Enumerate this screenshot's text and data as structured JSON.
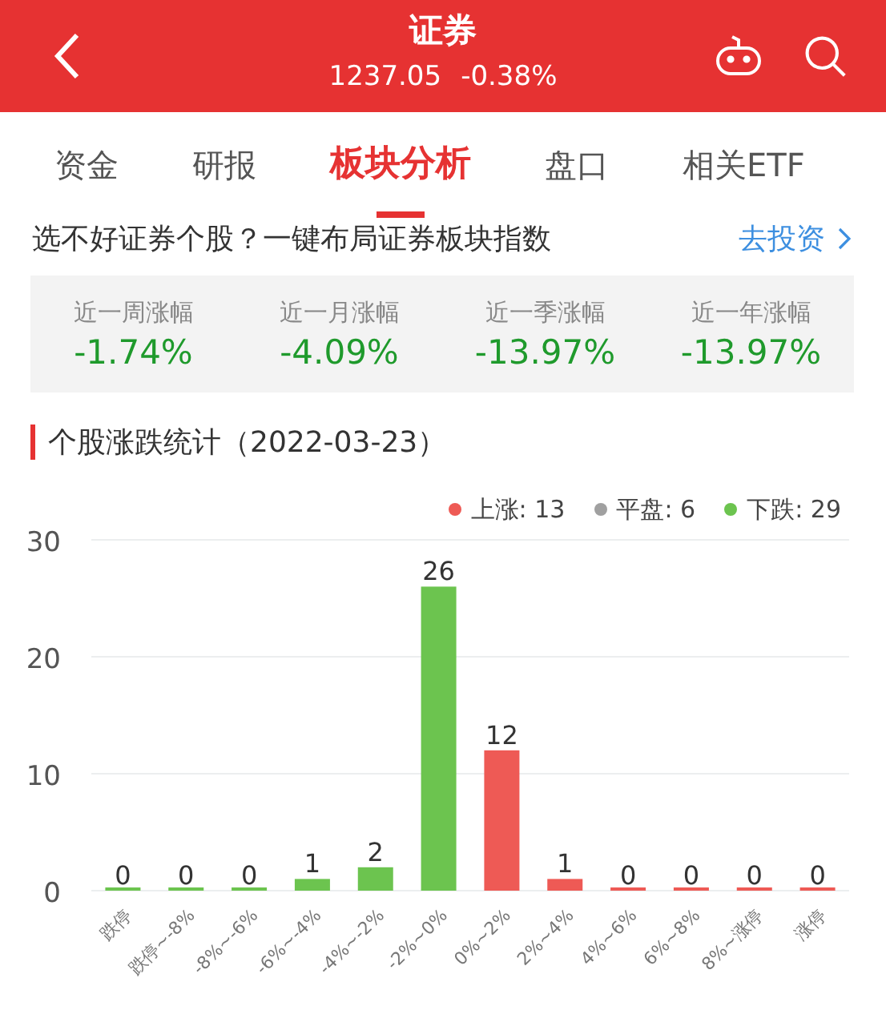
{
  "header": {
    "title": "证券",
    "price": "1237.05",
    "change": "-0.38%"
  },
  "tabs": [
    {
      "label": "资金",
      "selected": false
    },
    {
      "label": "研报",
      "selected": false
    },
    {
      "label": "板块分析",
      "selected": true
    },
    {
      "label": "盘口",
      "selected": false
    },
    {
      "label": "相关ETF",
      "selected": false
    }
  ],
  "promo": {
    "text": "选不好证券个股？一键布局证券板块指数",
    "link": "去投资"
  },
  "stats": [
    {
      "label": "近一周涨幅",
      "value": "-1.74%"
    },
    {
      "label": "近一月涨幅",
      "value": "-4.09%"
    },
    {
      "label": "近一季涨幅",
      "value": "-13.97%"
    },
    {
      "label": "近一年涨幅",
      "value": "-13.97%"
    }
  ],
  "section_title": "个股涨跌统计（2022-03-23）",
  "legend": [
    {
      "label": "上涨: 13",
      "color": "#ee5a55"
    },
    {
      "label": "平盘: 6",
      "color": "#a0a0a0"
    },
    {
      "label": "下跌: 29",
      "color": "#6cc44f"
    }
  ],
  "chart_data": {
    "type": "bar",
    "categories": [
      "跌停",
      "跌停~-8%",
      "-8%~-6%",
      "-6%~-4%",
      "-4%~-2%",
      "-2%~0%",
      "0%~2%",
      "2%~4%",
      "4%~6%",
      "6%~8%",
      "8%~涨停",
      "涨停"
    ],
    "series": [
      {
        "color": "#6cc44f",
        "values": [
          0,
          0,
          0,
          1,
          2,
          26,
          null,
          null,
          null,
          null,
          null,
          null
        ]
      },
      {
        "color": "#ee5a55",
        "values": [
          null,
          null,
          null,
          null,
          null,
          null,
          12,
          1,
          0,
          0,
          0,
          0
        ]
      }
    ],
    "ylim": [
      0,
      30
    ],
    "yticks": [
      0,
      10,
      20,
      30
    ],
    "data_labels": true
  }
}
